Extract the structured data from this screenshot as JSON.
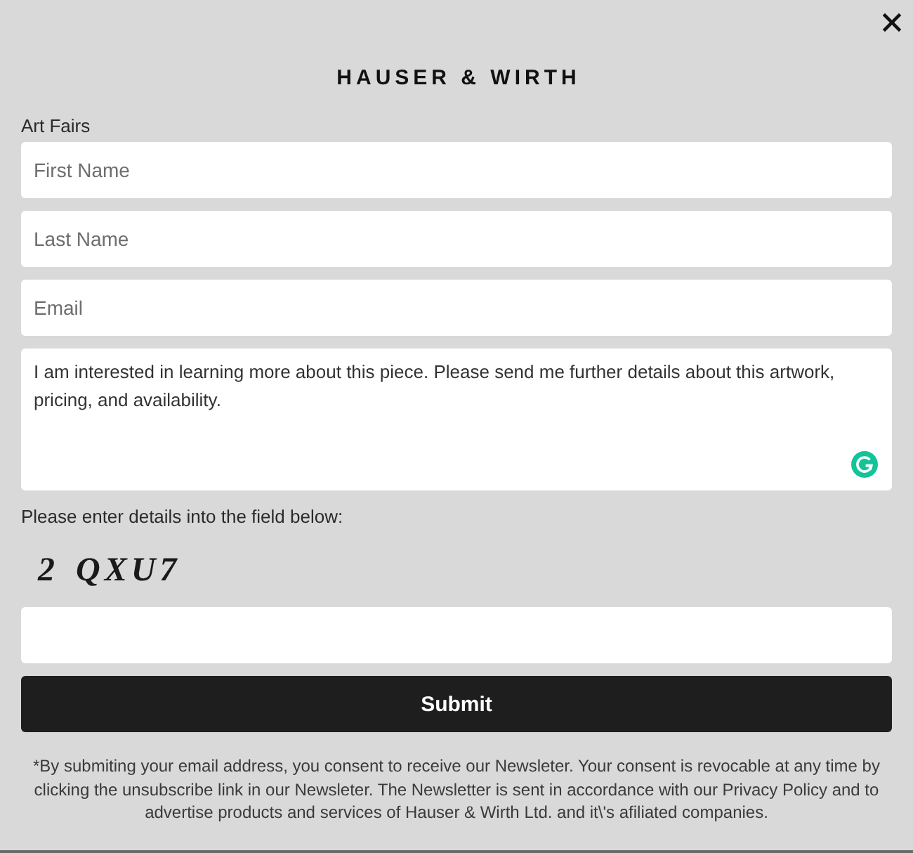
{
  "logo": {
    "text": "HAUSER & WIRTH"
  },
  "form": {
    "section_label": "Art Fairs",
    "fields": [
      {
        "kind": "input",
        "placeholder": "First Name"
      },
      {
        "kind": "input",
        "placeholder": "Last Name"
      },
      {
        "kind": "input",
        "placeholder": "Email"
      },
      {
        "kind": "textarea",
        "value": "I am interested in learning more about this piece. Please send me further details about this artwork, pricing, and availability."
      }
    ]
  },
  "captcha": {
    "prompt": "Please enter details into the field below:",
    "code": "2 QXU7"
  },
  "submit_button": {
    "label": "Submit"
  },
  "disclaimer": "*By submiting your email address, you consent to receive our Newsleter. Your consent is revocable at any time by clicking the unsubscribe link in our Newsleter. The Newsletter is sent in accordance with our Privacy Policy and to advertise products and services of Hauser & Wirth Ltd. and it\\'s afiliated companies."
}
